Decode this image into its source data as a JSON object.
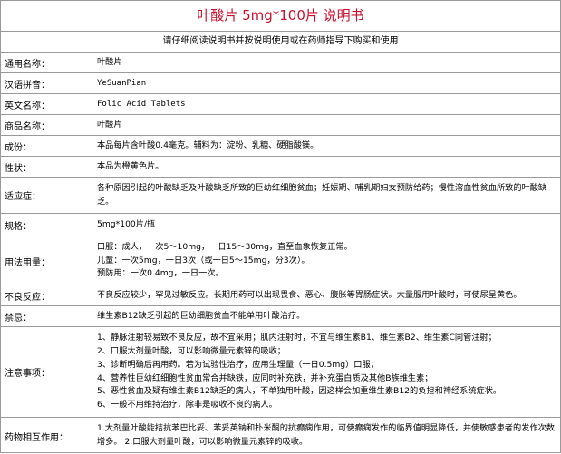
{
  "title": "叶酸片 5mg*100片 说明书",
  "notice": "请仔细阅读说明书并按说明使用或在药师指导下购买和使用",
  "rows": [
    {
      "label": "通用名称：",
      "lines": [
        "叶酸片"
      ]
    },
    {
      "label": "汉语拼音：",
      "lines": [
        "YeSuanPian"
      ]
    },
    {
      "label": "英文名称：",
      "lines": [
        "Folic Acid Tablets"
      ]
    },
    {
      "label": "商品名称：",
      "lines": [
        "叶酸片"
      ]
    },
    {
      "label": "成份：",
      "lines": [
        "本品每片含叶酸0.4毫克。辅料为：淀粉、乳糖、硬脂酸镁。"
      ]
    },
    {
      "label": "性状：",
      "lines": [
        "本品为橙黄色片。"
      ]
    },
    {
      "label": "适应症：",
      "lines": [
        "各种原因引起的叶酸缺乏及叶酸缺乏所致的巨幼红细胞贫血；妊娠期、哺乳期妇女预防给药；慢性溶血性贫血所致的叶酸缺乏。"
      ]
    },
    {
      "label": "规格：",
      "lines": [
        "5mg*100片/瓶"
      ]
    },
    {
      "label": "用法用量：",
      "lines": [
        "口服：成人，一次5～10mg，一日15～30mg，直至血象恢复正常。",
        "儿童：一次5mg，一日3次（或一日5～15mg，分3次）。",
        "预防用：一次0.4mg，一日一次。"
      ]
    },
    {
      "label": "不良反应：",
      "lines": [
        "不良反应较少，罕见过敏反应。长期用药可以出现畏食、恶心、腹胀等胃肠症状。大量服用叶酸时，可使尿呈黄色。"
      ]
    },
    {
      "label": "禁忌：",
      "lines": [
        "维生素B12缺乏引起的巨幼细胞贫血不能单用叶酸治疗。"
      ]
    },
    {
      "label": "注意事项：",
      "lines": [
        "1、静脉注射较易致不良反应，故不宜采用；肌内注射时，不宜与维生素B1、维生素B2、维生素C同管注射；",
        "2、口服大剂量叶酸，可以影响微量元素锌的吸收；",
        "3、诊断明确后再用药。若为试验性治疗，应用生理量（一日0.5mg）口服；",
        "4、营养性巨幼红细胞性贫血常合并缺铁，应同时补充铁，并补充蛋白质及其他B族维生素；",
        "5、恶性贫血及疑有维生素B12缺乏的病人，不单独用叶酸，因这样会加重维生素B12的负担和神经系统症状。",
        "6、一般不用维持治疗，除非是吸收不良的病人。"
      ]
    },
    {
      "label": "药物相互作用：",
      "lines": [
        "1.大剂量叶酸能拮抗苯巴比妥、苯妥英钠和扑米酮的抗癫痫作用，可使癫痫发作的临界值明显降低，并使敏感患者的发作次数增多。 2.口服大剂量叶酸，可以影响微量元素锌的吸收。"
      ]
    }
  ]
}
